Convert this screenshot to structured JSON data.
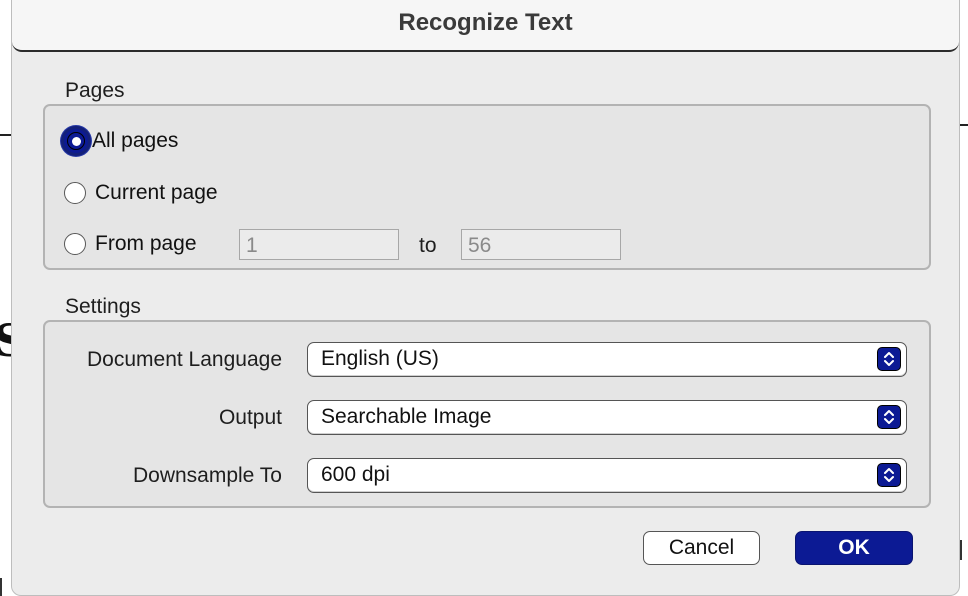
{
  "dialog": {
    "title": "Recognize Text"
  },
  "pages": {
    "section_label": "Pages",
    "options": [
      {
        "label": "All pages",
        "checked": true
      },
      {
        "label": "Current page",
        "checked": false
      },
      {
        "label": "From page",
        "checked": false
      }
    ],
    "from_value": "1",
    "to_label": "to",
    "to_value": "56"
  },
  "settings": {
    "section_label": "Settings",
    "document_language": {
      "label": "Document Language",
      "value": "English (US)"
    },
    "output": {
      "label": "Output",
      "value": "Searchable Image"
    },
    "downsample": {
      "label": "Downsample To",
      "value": "600 dpi"
    }
  },
  "buttons": {
    "cancel": "Cancel",
    "ok": "OK"
  },
  "colors": {
    "accent": "#0c1a94",
    "dialog_bg": "#ececec",
    "group_bg": "#e5e5e5"
  },
  "icons": {
    "select_arrows": "chevron-up-down-icon"
  }
}
